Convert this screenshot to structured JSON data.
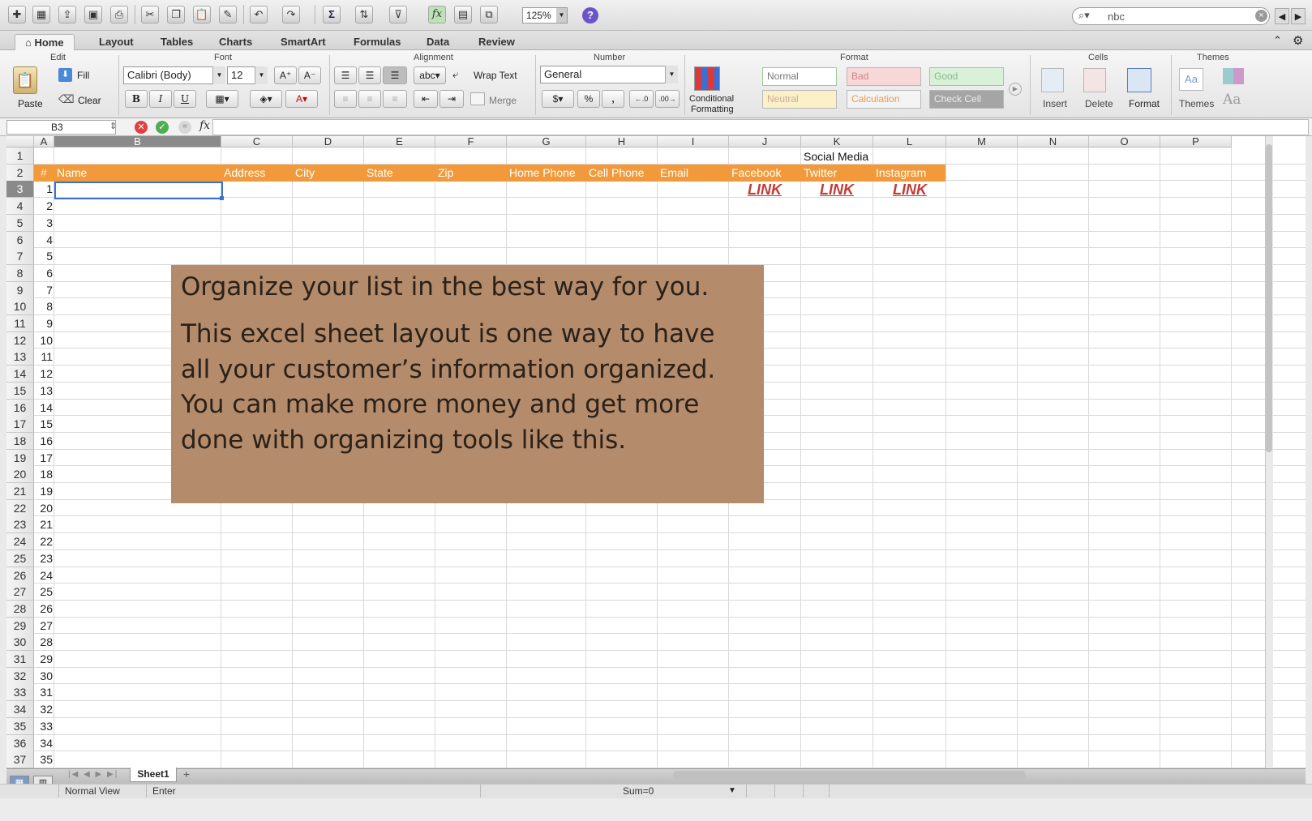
{
  "toolbar": {
    "zoom": "125%",
    "search_value": "nbc",
    "icons": [
      "new-workbook-icon",
      "template-gallery-icon",
      "open-icon",
      "save-icon",
      "print-icon",
      "cut-icon",
      "copy-icon",
      "paste-icon",
      "format-painter-icon",
      "undo-icon",
      "redo-icon",
      "autosum-icon",
      "sort-icon",
      "filter-icon",
      "formula-builder-icon",
      "show-gallery-icon",
      "toolbox-icon",
      "help-icon"
    ]
  },
  "tabs": [
    "Home",
    "Layout",
    "Tables",
    "Charts",
    "SmartArt",
    "Formulas",
    "Data",
    "Review"
  ],
  "ribbon": {
    "groups": [
      "Edit",
      "Font",
      "Alignment",
      "Number",
      "Format",
      "Cells",
      "Themes"
    ],
    "edit": {
      "paste": "Paste",
      "fill": "Fill",
      "clear": "Clear"
    },
    "font": {
      "name": "Calibri (Body)",
      "size": "12",
      "bold": "B",
      "italic": "I",
      "underline": "U"
    },
    "alignment": {
      "wrap": "Wrap Text",
      "merge": "Merge",
      "orientation": "abc"
    },
    "number": {
      "format": "General",
      "percent": "%",
      "comma": ","
    },
    "format": {
      "conditional_line1": "Conditional",
      "conditional_line2": "Formatting",
      "styles": [
        "Normal",
        "Bad",
        "Good",
        "Neutral",
        "Calculation",
        "Check Cell"
      ]
    },
    "cells": {
      "insert": "Insert",
      "delete": "Delete",
      "format": "Format"
    },
    "themes": {
      "themes": "Themes",
      "aa": "Aa",
      "font_aa": "Aa"
    }
  },
  "formula_bar": {
    "cell_ref": "B3",
    "fx": "fx",
    "value": ""
  },
  "grid": {
    "columns": [
      "A",
      "B",
      "C",
      "D",
      "E",
      "F",
      "G",
      "H",
      "I",
      "J",
      "K",
      "L",
      "M",
      "N",
      "O",
      "P"
    ],
    "rows": [
      "1",
      "2",
      "3",
      "4",
      "5",
      "6",
      "7",
      "8",
      "9",
      "10",
      "11",
      "12",
      "13",
      "14",
      "15",
      "16",
      "17",
      "18",
      "19",
      "20",
      "21",
      "22",
      "23",
      "24",
      "25",
      "26",
      "27",
      "28",
      "29",
      "30",
      "31",
      "32",
      "33",
      "34",
      "35",
      "36",
      "37"
    ],
    "selected_col": "B",
    "selected_row": "3",
    "row1_label": "Social Media",
    "header_row": [
      "#",
      "Name",
      "Address",
      "City",
      "State",
      "Zip",
      "Home Phone",
      "Cell Phone",
      "Email",
      "Facebook",
      "Twitter",
      "Instagram"
    ],
    "numbers": [
      "1",
      "2",
      "3",
      "4",
      "5",
      "6",
      "7",
      "8",
      "9",
      "10",
      "11",
      "12",
      "13",
      "14",
      "15",
      "16",
      "17",
      "18",
      "19",
      "20",
      "21",
      "22",
      "23",
      "24",
      "25",
      "26",
      "27",
      "28",
      "29",
      "30",
      "31",
      "32",
      "33",
      "34",
      "35"
    ],
    "link_text": "LINK"
  },
  "note": {
    "title": "Organize your list in the best way for you.",
    "body_lines": [
      "This excel sheet layout is one way to have",
      "all your customer’s information organized.",
      "You can make more money and get more",
      "done with organizing tools like this."
    ]
  },
  "sheets": {
    "active": "Sheet1",
    "add": "+"
  },
  "status": {
    "view": "Normal View",
    "mode": "Enter",
    "sum": "Sum=0"
  },
  "colors": {
    "header_band": "#f29a3b",
    "note_bg": "#b48b6b",
    "link": "#c23c36",
    "selection": "#3874c9"
  }
}
